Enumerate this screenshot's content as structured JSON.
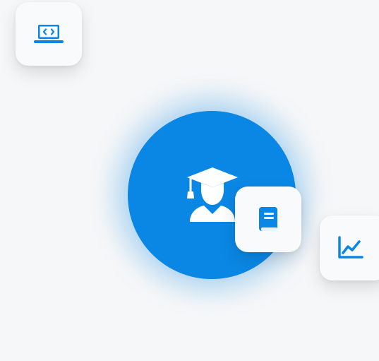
{
  "accent_color": "#0a87e4",
  "icons": {
    "center": "graduate-icon",
    "top_left": "code-laptop-icon",
    "book": "book-icon",
    "chart": "trend-chart-icon"
  }
}
